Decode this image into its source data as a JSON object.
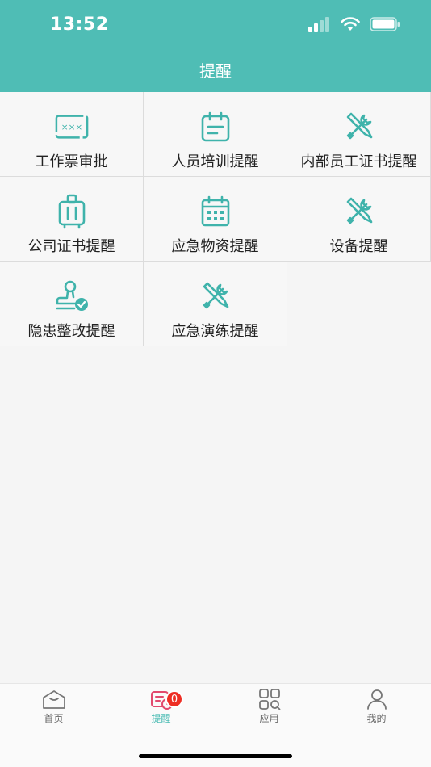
{
  "status_bar": {
    "time": "13:52"
  },
  "header": {
    "title": "提醒"
  },
  "grid": {
    "items": [
      {
        "label": "工作票审批",
        "icon": "ticket-icon"
      },
      {
        "label": "人员培训提醒",
        "icon": "calendar-note-icon"
      },
      {
        "label": "内部员工证书提醒",
        "icon": "tools-icon"
      },
      {
        "label": "公司证书提醒",
        "icon": "suitcase-icon"
      },
      {
        "label": "应急物资提醒",
        "icon": "calendar-grid-icon"
      },
      {
        "label": "设备提醒",
        "icon": "tools-icon"
      },
      {
        "label": "隐患整改提醒",
        "icon": "stamp-check-icon"
      },
      {
        "label": "应急演练提醒",
        "icon": "tools-icon"
      }
    ]
  },
  "tabbar": {
    "tabs": [
      {
        "label": "首页",
        "icon": "home-icon"
      },
      {
        "label": "提醒",
        "icon": "reminder-icon",
        "badge": "0",
        "active": true
      },
      {
        "label": "应用",
        "icon": "apps-icon"
      },
      {
        "label": "我的",
        "icon": "user-icon"
      }
    ]
  },
  "colors": {
    "accent": "#4fbdb5",
    "badge": "#ee2e24",
    "icon_teal": "#3fb3ab"
  }
}
